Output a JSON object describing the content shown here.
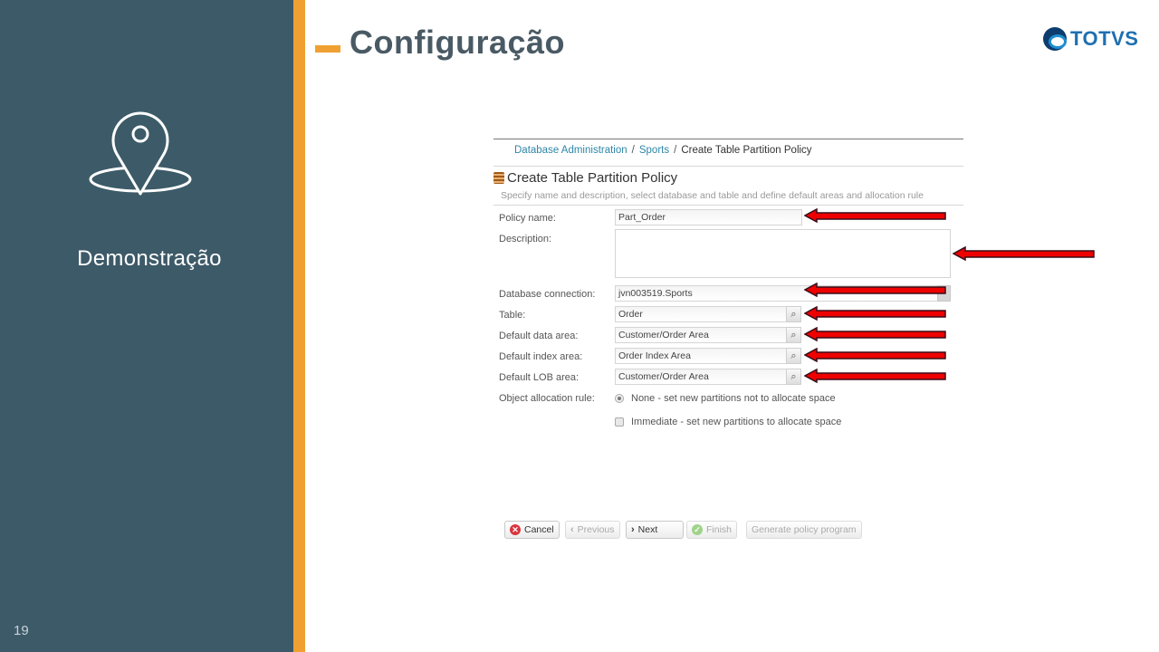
{
  "slide": {
    "section_label": "Demonstração",
    "page_number": "19",
    "title": "Configuração",
    "logo_text": "TOTVS",
    "accent_color": "#f0a030",
    "sidebar_color": "#3d5a68",
    "sidebar_icon": "location-pin-icon"
  },
  "screenshot": {
    "breadcrumb": [
      {
        "label": "Database Administration",
        "link": true
      },
      {
        "label": "Sports",
        "link": true
      },
      {
        "label": "Create Table Partition Policy",
        "link": false
      }
    ],
    "breadcrumb_separator": "/",
    "form_title": "Create Table Partition Policy",
    "form_subtitle": "Specify name and description, select database and table and define default areas and allocation rule",
    "fields": {
      "policy_name": {
        "label": "Policy name:",
        "value": "Part_Order"
      },
      "description": {
        "label": "Description:",
        "value": ""
      },
      "database_connection": {
        "label": "Database connection:",
        "value": "jvn003519.Sports"
      },
      "table": {
        "label": "Table:",
        "value": "Order"
      },
      "default_data_area": {
        "label": "Default data area:",
        "value": "Customer/Order Area"
      },
      "default_index_area": {
        "label": "Default index area:",
        "value": "Order Index Area"
      },
      "default_lob_area": {
        "label": "Default LOB area:",
        "value": "Customer/Order Area"
      }
    },
    "allocation_rule": {
      "label": "Object allocation rule:",
      "options": [
        {
          "label": "None - set new partitions not to allocate space",
          "selected": true
        },
        {
          "label": "Immediate - set new partitions to allocate space",
          "selected": false
        }
      ]
    },
    "buttons": {
      "cancel": "Cancel",
      "previous": "Previous",
      "next": "Next",
      "finish": "Finish",
      "generate": "Generate policy program"
    },
    "annotation_color": "#ee0000"
  }
}
